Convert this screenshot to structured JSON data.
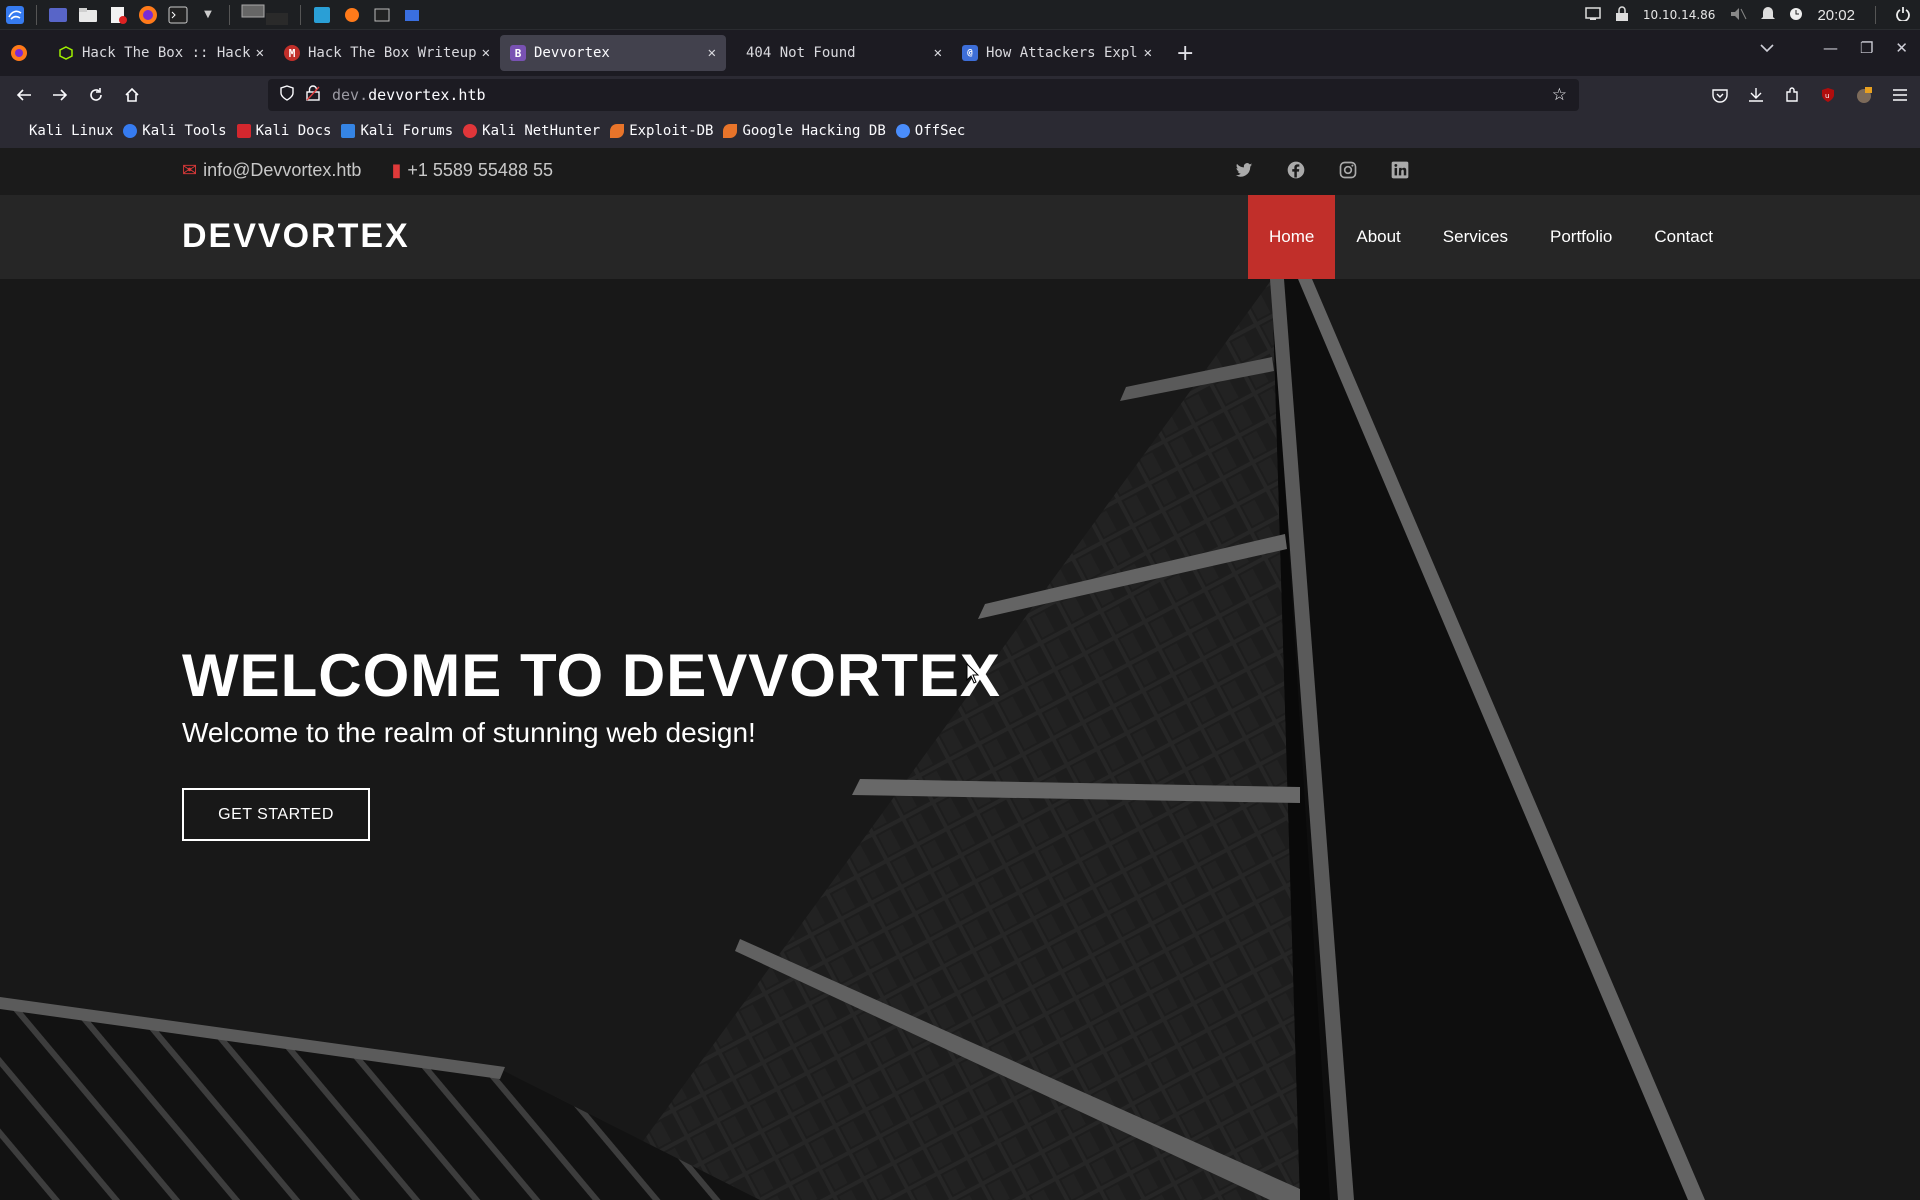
{
  "os_panel": {
    "ip": "10.10.14.86",
    "clock": "20:02"
  },
  "tabs": [
    {
      "title": "Hack The Box :: Hack The Box",
      "favicon": "htb-cube-icon",
      "active": false
    },
    {
      "title": "Hack The Box Writeups",
      "favicon": "medium-icon",
      "active": false
    },
    {
      "title": "Devvortex",
      "favicon": "bootstrap-icon",
      "active": true
    },
    {
      "title": "404 Not Found",
      "favicon": "",
      "active": false
    },
    {
      "title": "How Attackers Exploit",
      "favicon": "globe-icon",
      "active": false
    }
  ],
  "url": {
    "sub": "dev.",
    "domain": "devvortex.htb"
  },
  "bookmarks": [
    {
      "label": "Kali Linux",
      "color": "#2c2c2c"
    },
    {
      "label": "Kali Tools",
      "color": "#367bf0"
    },
    {
      "label": "Kali Docs",
      "color": "#d3272e"
    },
    {
      "label": "Kali Forums",
      "color": "#3584e4"
    },
    {
      "label": "Kali NetHunter",
      "color": "#e0363a"
    },
    {
      "label": "Exploit-DB",
      "color": "#e8742a"
    },
    {
      "label": "Google Hacking DB",
      "color": "#e8742a"
    },
    {
      "label": "OffSec",
      "color": "#4a8dfc"
    }
  ],
  "site": {
    "email": "info@Devvortex.htb",
    "phone": "+1 5589 55488 55",
    "logo": "DEVVORTEX",
    "menu": [
      "Home",
      "About",
      "Services",
      "Portfolio",
      "Contact"
    ],
    "hero_title": "WELCOME TO DEVVORTEX",
    "hero_subtitle": "Welcome to the realm of stunning web design!",
    "hero_button": "GET STARTED",
    "social": [
      "twitter-icon",
      "facebook-icon",
      "instagram-icon",
      "linkedin-icon"
    ],
    "accent": "#c12f2a"
  }
}
